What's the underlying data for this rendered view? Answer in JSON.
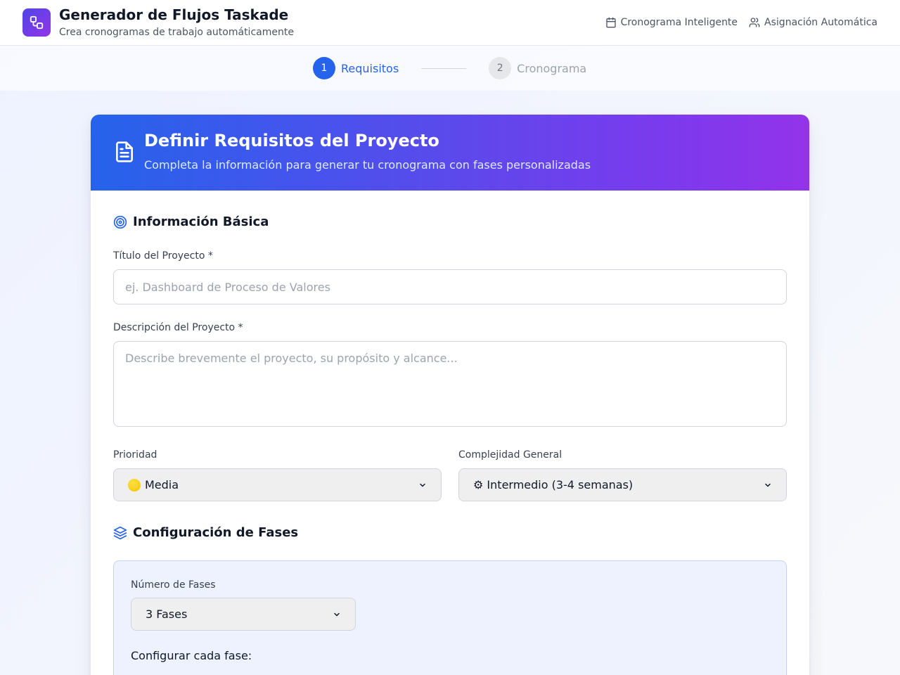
{
  "header": {
    "title": "Generador de Flujos Taskade",
    "subtitle": "Crea cronogramas de trabajo automáticamente",
    "links": [
      {
        "label": "Cronograma Inteligente",
        "icon": "calendar-icon"
      },
      {
        "label": "Asignación Automática",
        "icon": "users-icon"
      }
    ]
  },
  "stepper": {
    "steps": [
      {
        "number": "1",
        "label": "Requisitos",
        "active": true
      },
      {
        "number": "2",
        "label": "Cronograma",
        "active": false
      }
    ]
  },
  "card": {
    "title": "Definir Requisitos del Proyecto",
    "subtitle": "Completa la información para generar tu cronograma con fases personalizadas",
    "icon": "document-icon"
  },
  "basic_info": {
    "section_title": "Información Básica",
    "title_label": "Título del Proyecto *",
    "title_placeholder": "ej. Dashboard de Proceso de Valores",
    "title_value": "",
    "description_label": "Descripción del Proyecto *",
    "description_placeholder": "Describe brevemente el proyecto, su propósito y alcance...",
    "description_value": "",
    "priority_label": "Prioridad",
    "priority_value": "Media",
    "complexity_label": "Complejidad General",
    "complexity_value": "⚙ Intermedio (3-4 semanas)"
  },
  "phases": {
    "section_title": "Configuración de Fases",
    "count_label": "Número de Fases",
    "count_value": "3 Fases",
    "configure_label": "Configurar cada fase:"
  },
  "colors": {
    "accent": "#2563eb",
    "gradient_start": "#2563eb",
    "gradient_end": "#9333ea",
    "phase_box_bg": "#eef2ff"
  }
}
